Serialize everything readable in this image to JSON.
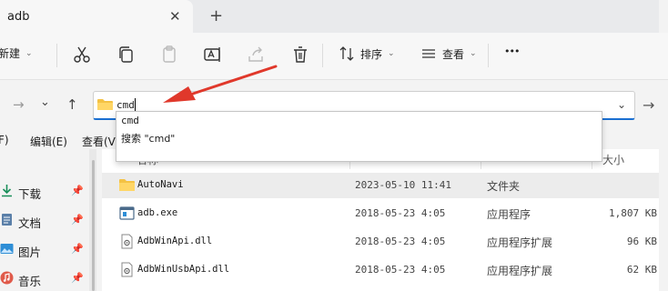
{
  "tab": {
    "title": "adb",
    "close_glyph": "✕",
    "new_glyph": "+"
  },
  "toolbar": {
    "new_label": "新建",
    "sort_label": "排序",
    "view_label": "查看",
    "more_glyph": "•••",
    "chevron_glyph": "⌄"
  },
  "nav": {
    "forward_glyph": "→",
    "recent_glyph": "⌄",
    "up_glyph": "↑",
    "go_glyph": "→"
  },
  "address": {
    "value": "cmd",
    "dropdown_glyph": "⌄"
  },
  "autocomplete": {
    "items": [
      "cmd",
      "搜索 \"cmd\""
    ]
  },
  "menubar": {
    "file_partial": "F)",
    "edit": "编辑(E)",
    "view_partial": "查看(V"
  },
  "sidebar": {
    "items": [
      {
        "label": "下载",
        "icon": "download-icon"
      },
      {
        "label": "文档",
        "icon": "document-icon"
      },
      {
        "label": "图片",
        "icon": "picture-icon"
      },
      {
        "label": "音乐",
        "icon": "music-icon"
      }
    ],
    "pin_glyph": "📌"
  },
  "columns": {
    "name": "名称",
    "date": "",
    "type": "",
    "size_partial": "大小"
  },
  "files": [
    {
      "name": "AutoNavi",
      "date": "2023-05-10 11:41",
      "type": "文件夹",
      "size": "",
      "icon": "folder-icon"
    },
    {
      "name": "adb.exe",
      "date": "2018-05-23 4:05",
      "type": "应用程序",
      "size": "1,807 KB",
      "icon": "exe-icon"
    },
    {
      "name": "AdbWinApi.dll",
      "date": "2018-05-23 4:05",
      "type": "应用程序扩展",
      "size": "96 KB",
      "icon": "dll-icon"
    },
    {
      "name": "AdbWinUsbApi.dll",
      "date": "2018-05-23 4:05",
      "type": "应用程序扩展",
      "size": "62 KB",
      "icon": "dll-icon"
    }
  ],
  "colors": {
    "accent": "#1a6fd1",
    "arrow": "#e0382b",
    "folder": "#f4c244"
  }
}
